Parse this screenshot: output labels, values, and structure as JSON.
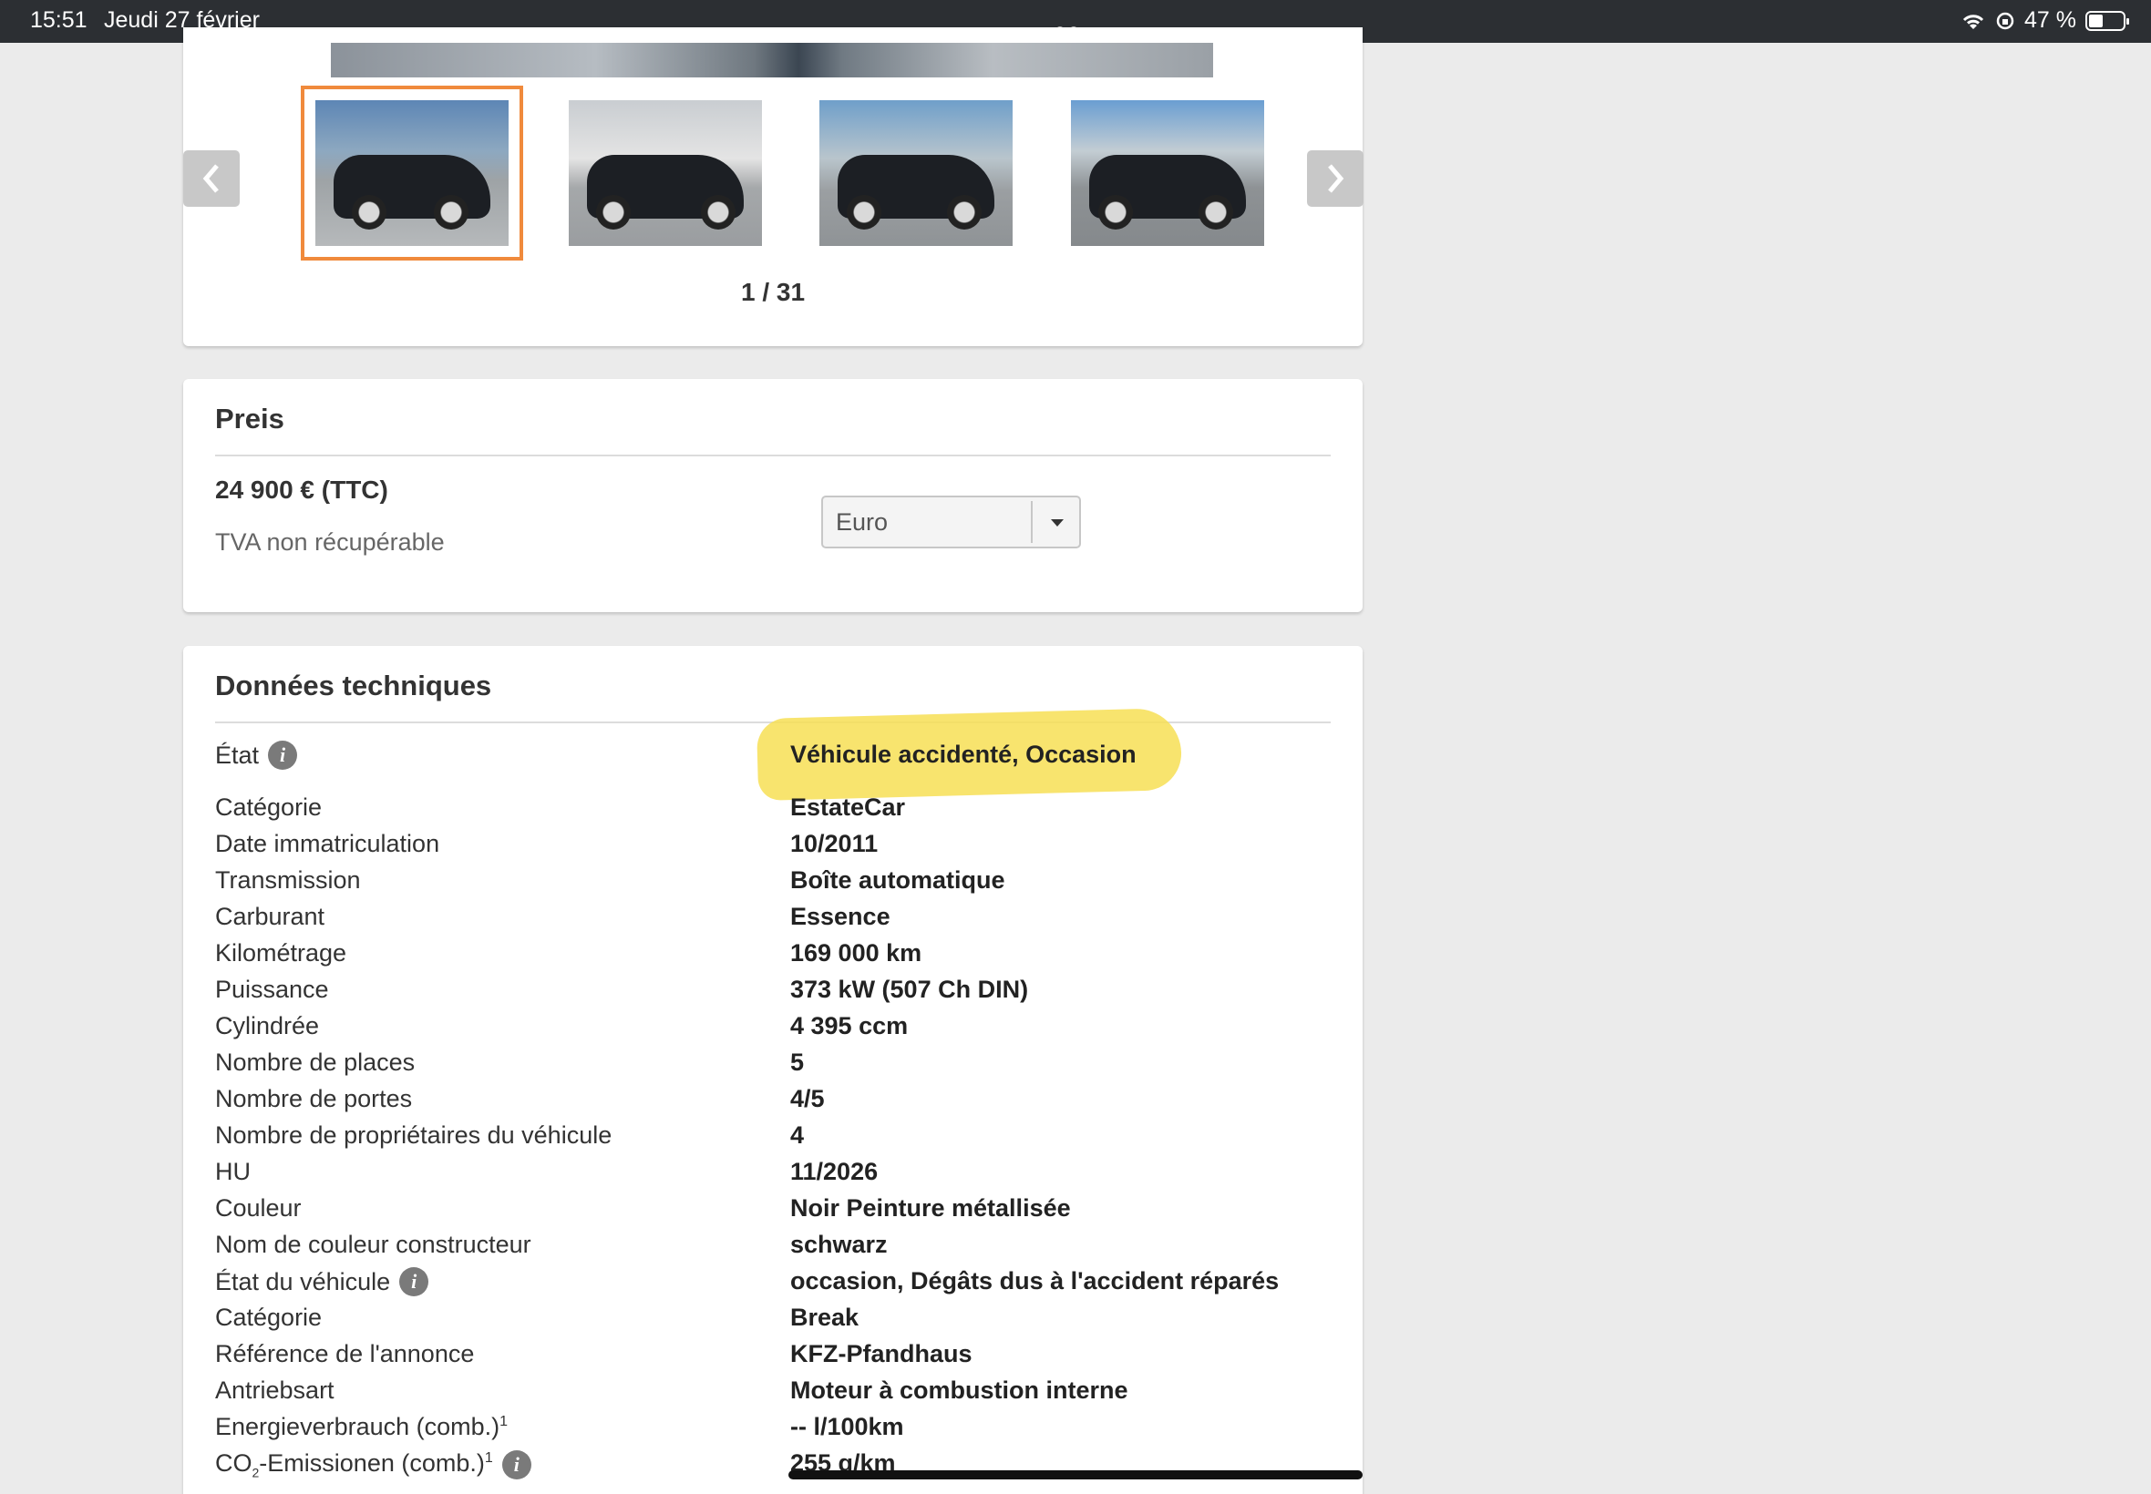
{
  "status_bar": {
    "time": "15:51",
    "date": "Jeudi 27 février",
    "battery": "47 %",
    "battery_level": 0.47
  },
  "gallery": {
    "counter": "1 / 31",
    "thumbnails": [
      "car-front-quarter",
      "car-side",
      "car-side-parking",
      "car-rear-quarter"
    ],
    "selected_index": 0,
    "accent_color": "#f08a3c"
  },
  "price": {
    "title": "Preis",
    "amount": "24 900 € (TTC)",
    "vat_note": "TVA non récupérable",
    "currency_select": "Euro"
  },
  "tech": {
    "title": "Données techniques",
    "rows": [
      {
        "label": "État",
        "value": "Véhicule accidenté, Occasion"
      },
      {
        "label": "Catégorie",
        "value": "EstateCar"
      },
      {
        "label": "Date immatriculation",
        "value": "10/2011"
      },
      {
        "label": "Transmission",
        "value": "Boîte automatique"
      },
      {
        "label": "Carburant",
        "value": "Essence"
      },
      {
        "label": "Kilométrage",
        "value": "169 000 km"
      },
      {
        "label": "Puissance",
        "value": "373 kW (507 Ch DIN)"
      },
      {
        "label": "Cylindrée",
        "value": "4 395 ccm"
      },
      {
        "label": "Nombre de places",
        "value": "5"
      },
      {
        "label": "Nombre de portes",
        "value": "4/5"
      },
      {
        "label": "Nombre de propriétaires du véhicule",
        "value": "4"
      },
      {
        "label": "HU",
        "value": "11/2026"
      },
      {
        "label": "Couleur",
        "value": "Noir Peinture métallisée"
      },
      {
        "label": "Nom de couleur constructeur",
        "value": "schwarz"
      },
      {
        "label": "État du véhicule",
        "value": "occasion, Dégâts dus à l'accident réparés"
      },
      {
        "label": "Catégorie",
        "value": "Break"
      },
      {
        "label": "Référence de l'annonce",
        "value": "KFZ-Pfandhaus"
      },
      {
        "label": "Antriebsart",
        "value": "Moteur à combustion interne"
      },
      {
        "label": "Energieverbrauch (comb.)",
        "label_sup": "1",
        "value": "-- l/100km"
      },
      {
        "label_pre": "CO",
        "label_sub": "2",
        "label": "-Emissionen (comb.)",
        "label_sup": "1",
        "value": "255 g/km"
      }
    ]
  }
}
